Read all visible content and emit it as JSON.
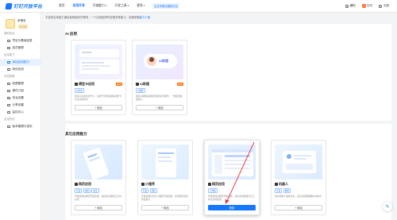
{
  "brand": {
    "logo_text": "钉钉开放平台",
    "color": "#1677ff"
  },
  "topnav": {
    "items": [
      {
        "label": "首页"
      },
      {
        "label": "应用开发",
        "active": true
      },
      {
        "label": "开放能力",
        "caret": "▾"
      },
      {
        "label": "开发工具",
        "caret": "▾"
      },
      {
        "label": "更多",
        "caret": "▾"
      }
    ],
    "badge": "企业专属大模型平台",
    "right": [
      {
        "label": "通知"
      },
      {
        "label": "钉钉"
      },
      {
        "label": "文档"
      }
    ]
  },
  "sidebar": {
    "org_name": "承德世",
    "org_tag": "已认证",
    "groups": [
      {
        "title": "基础信息",
        "items": [
          {
            "label": "凭证与基础信息"
          },
          {
            "label": "成员管理"
          }
        ]
      },
      {
        "title": "应用能力",
        "items": [
          {
            "label": "添加应用能力",
            "active": true
          },
          {
            "label": "网页应用"
          }
        ]
      },
      {
        "title": "开发配置",
        "items": [
          {
            "label": "权限管理"
          },
          {
            "label": "事件订阅"
          },
          {
            "label": "安全设置"
          },
          {
            "label": "分享设置"
          },
          {
            "label": "监控中心"
          }
        ]
      },
      {
        "title": "应用发布",
        "items": [
          {
            "label": "版本管理与发布"
          }
        ]
      }
    ]
  },
  "main": {
    "notice_text": "丰富的应用能力满足各种组织员需求，一个应用能同时挂载多种能力，快速掌握",
    "notice_link": "能力介绍",
    "ai_section": {
      "title": "AI 应用",
      "cards": [
        {
          "title": "模型卡应用",
          "badge": "NEW",
          "tags": [
            "AI应用"
          ],
          "desc": "通过AI生成对话卡片，适用于智能客服等需要卡片交互的场景",
          "button": "+ 添加"
        },
        {
          "title": "AI助理",
          "badge": "NEW",
          "tags": [
            "AI助理"
          ],
          "desc": "通过AI助理完成更智能的对话服务，一键配置模型能力",
          "button": "+ 添加",
          "img_label": "AI助理"
        }
      ]
    },
    "other_section": {
      "title": "其它应用能力",
      "cards": [
        {
          "title": "网页应用",
          "tags": [
            "开发",
            "在线",
            "更多"
          ],
          "desc": "开发者通过网页开发应用，通过浏览器或工作台访问",
          "button": "+ 添加"
        },
        {
          "title": "小程序",
          "tags": [
            "开发",
            "审核"
          ],
          "desc": "开发者通过钉钉小程序开发应用，支持更丰富的原生能力",
          "button": "+ 添加"
        },
        {
          "title": "网页应用",
          "tags": [
            "已添加"
          ],
          "desc": "开发者通过网页开发应用，通过浏览器或钉钉工作台访问使用",
          "button": "配置",
          "highlight": true
        },
        {
          "title": "机器人",
          "tags": [
            "开发",
            "群聊"
          ],
          "desc": "通过机器人收发消息，自动化处理群聊中的事务",
          "button": "+ 添加"
        }
      ]
    }
  },
  "float_button_icon": "magic-wand-icon",
  "arrow_color": "#e53935"
}
